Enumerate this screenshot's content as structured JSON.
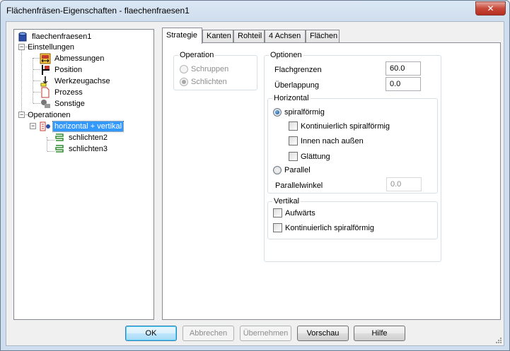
{
  "window": {
    "title": "Flächenfräsen-Eigenschaften - flaechenfraesen1",
    "close_glyph": "✕"
  },
  "tree": {
    "root": "flaechenfraesen1",
    "settings": "Einstellungen",
    "settings_children": [
      "Abmessungen",
      "Position",
      "Werkzeugachse",
      "Prozess",
      "Sonstige"
    ],
    "operations": "Operationen",
    "operation_group": "horizontal + vertikal",
    "operation_children": [
      "schlichten2",
      "schlichten3"
    ]
  },
  "tabs": [
    "Strategie",
    "Kanten",
    "Rohteil",
    "4 Achsen",
    "Flächen"
  ],
  "operation_group": {
    "title": "Operation",
    "schruppen": "Schruppen",
    "schlichten": "Schlichten"
  },
  "options_group": {
    "title": "Optionen",
    "flachgrenzen_label": "Flachgrenzen",
    "flachgrenzen_value": "60.0",
    "ueberlappung_label": "Überlappung",
    "ueberlappung_value": "0.0"
  },
  "horizontal_group": {
    "title": "Horizontal",
    "spiral": "spiralförmig",
    "kontinuierlich": "Kontinuierlich spiralförmig",
    "innen_aussen": "Innen nach außen",
    "glaettung": "Glättung",
    "parallel": "Parallel",
    "parallelwinkel_label": "Parallelwinkel",
    "parallelwinkel_value": "0.0"
  },
  "vertical_group": {
    "title": "Vertikal",
    "aufwaerts": "Aufwärts",
    "kontinuierlich": "Kontinuierlich spiralförmig"
  },
  "buttons": {
    "ok": "OK",
    "abbrechen": "Abbrechen",
    "uebernehmen": "Übernehmen",
    "vorschau": "Vorschau",
    "hilfe": "Hilfe"
  }
}
